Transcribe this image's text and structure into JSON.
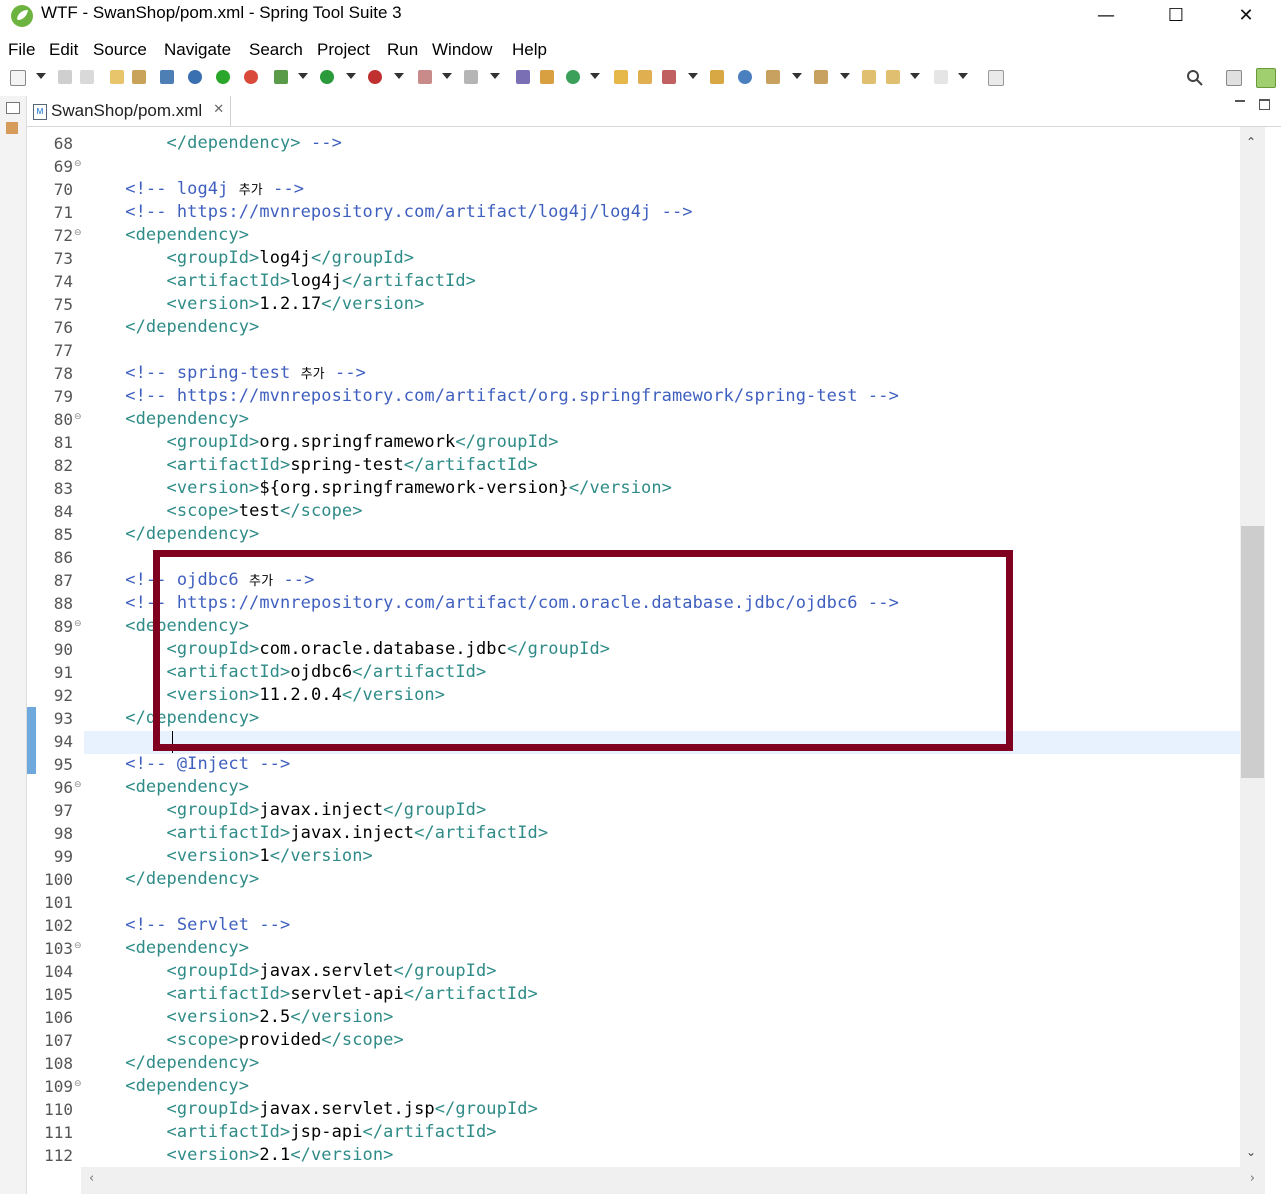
{
  "window": {
    "title": "WTF - SwanShop/pom.xml - Spring Tool Suite 3",
    "minimize": "—",
    "maximize": "☐",
    "close": "✕"
  },
  "menu": [
    "File",
    "Edit",
    "Source",
    "Navigate",
    "Search",
    "Project",
    "Run",
    "Window",
    "Help"
  ],
  "tab": {
    "label": "SwanShop/pom.xml",
    "close": "✕",
    "icon": "M"
  },
  "editor": {
    "lines": [
      {
        "n": "68",
        "fold": "",
        "parts": [
          [
            "i",
            "        "
          ],
          [
            "tag",
            "</dependency>"
          ],
          [
            "cmt",
            " -->"
          ]
        ]
      },
      {
        "n": "69",
        "fold": "⊖",
        "parts": []
      },
      {
        "n": "70",
        "fold": "",
        "parts": [
          [
            "i",
            "    "
          ],
          [
            "cmt",
            "<!-- log4j "
          ],
          [
            "ko",
            "추가"
          ],
          [
            "cmt",
            " -->"
          ]
        ]
      },
      {
        "n": "71",
        "fold": "",
        "parts": [
          [
            "i",
            "    "
          ],
          [
            "cmt",
            "<!-- https://mvnrepository.com/artifact/log4j/log4j -->"
          ]
        ]
      },
      {
        "n": "72",
        "fold": "⊖",
        "parts": [
          [
            "i",
            "    "
          ],
          [
            "tag",
            "<dependency>"
          ]
        ]
      },
      {
        "n": "73",
        "fold": "",
        "parts": [
          [
            "i",
            "        "
          ],
          [
            "tag",
            "<groupId>"
          ],
          [
            "txt",
            "log4j"
          ],
          [
            "tag",
            "</groupId>"
          ]
        ]
      },
      {
        "n": "74",
        "fold": "",
        "parts": [
          [
            "i",
            "        "
          ],
          [
            "tag",
            "<artifactId>"
          ],
          [
            "txt",
            "log4j"
          ],
          [
            "tag",
            "</artifactId>"
          ]
        ]
      },
      {
        "n": "75",
        "fold": "",
        "parts": [
          [
            "i",
            "        "
          ],
          [
            "tag",
            "<version>"
          ],
          [
            "txt",
            "1.2.17"
          ],
          [
            "tag",
            "</version>"
          ]
        ]
      },
      {
        "n": "76",
        "fold": "",
        "parts": [
          [
            "i",
            "    "
          ],
          [
            "tag",
            "</dependency>"
          ]
        ]
      },
      {
        "n": "77",
        "fold": "",
        "parts": []
      },
      {
        "n": "78",
        "fold": "",
        "parts": [
          [
            "i",
            "    "
          ],
          [
            "cmt",
            "<!-- spring-test "
          ],
          [
            "ko",
            "추가"
          ],
          [
            "cmt",
            " -->"
          ]
        ]
      },
      {
        "n": "79",
        "fold": "",
        "parts": [
          [
            "i",
            "    "
          ],
          [
            "cmt",
            "<!-- https://mvnrepository.com/artifact/org.springframework/spring-test -->"
          ]
        ]
      },
      {
        "n": "80",
        "fold": "⊖",
        "parts": [
          [
            "i",
            "    "
          ],
          [
            "tag",
            "<dependency>"
          ]
        ]
      },
      {
        "n": "81",
        "fold": "",
        "parts": [
          [
            "i",
            "        "
          ],
          [
            "tag",
            "<groupId>"
          ],
          [
            "txt",
            "org.springframework"
          ],
          [
            "tag",
            "</groupId>"
          ]
        ]
      },
      {
        "n": "82",
        "fold": "",
        "parts": [
          [
            "i",
            "        "
          ],
          [
            "tag",
            "<artifactId>"
          ],
          [
            "txt",
            "spring-test"
          ],
          [
            "tag",
            "</artifactId>"
          ]
        ]
      },
      {
        "n": "83",
        "fold": "",
        "parts": [
          [
            "i",
            "        "
          ],
          [
            "tag",
            "<version>"
          ],
          [
            "txt",
            "${org.springframework-version}"
          ],
          [
            "tag",
            "</version>"
          ]
        ]
      },
      {
        "n": "84",
        "fold": "",
        "parts": [
          [
            "i",
            "        "
          ],
          [
            "tag",
            "<scope>"
          ],
          [
            "txt",
            "test"
          ],
          [
            "tag",
            "</scope>"
          ]
        ]
      },
      {
        "n": "85",
        "fold": "",
        "parts": [
          [
            "i",
            "    "
          ],
          [
            "tag",
            "</dependency>"
          ]
        ]
      },
      {
        "n": "86",
        "fold": "",
        "parts": []
      },
      {
        "n": "87",
        "fold": "",
        "parts": [
          [
            "i",
            "    "
          ],
          [
            "cmt",
            "<!-- ojdbc6 "
          ],
          [
            "ko",
            "추가"
          ],
          [
            "cmt",
            " -->"
          ]
        ]
      },
      {
        "n": "88",
        "fold": "",
        "parts": [
          [
            "i",
            "    "
          ],
          [
            "cmt",
            "<!-- https://mvnrepository.com/artifact/com.oracle.database.jdbc/ojdbc6 -->"
          ]
        ]
      },
      {
        "n": "89",
        "fold": "⊖",
        "parts": [
          [
            "i",
            "    "
          ],
          [
            "tag",
            "<dependency>"
          ]
        ]
      },
      {
        "n": "90",
        "fold": "",
        "parts": [
          [
            "i",
            "        "
          ],
          [
            "tag",
            "<groupId>"
          ],
          [
            "txt",
            "com.oracle.database.jdbc"
          ],
          [
            "tag",
            "</groupId>"
          ]
        ]
      },
      {
        "n": "91",
        "fold": "",
        "parts": [
          [
            "i",
            "        "
          ],
          [
            "tag",
            "<artifactId>"
          ],
          [
            "txt",
            "ojdbc6"
          ],
          [
            "tag",
            "</artifactId>"
          ]
        ]
      },
      {
        "n": "92",
        "fold": "",
        "parts": [
          [
            "i",
            "        "
          ],
          [
            "tag",
            "<version>"
          ],
          [
            "txt",
            "11.2.0.4"
          ],
          [
            "tag",
            "</version>"
          ]
        ]
      },
      {
        "n": "93",
        "fold": "",
        "parts": [
          [
            "i",
            "    "
          ],
          [
            "tag",
            "</dependency>"
          ]
        ]
      },
      {
        "n": "94",
        "fold": "",
        "parts": []
      },
      {
        "n": "95",
        "fold": "",
        "parts": [
          [
            "i",
            "    "
          ],
          [
            "cmt",
            "<!-- @Inject -->"
          ]
        ]
      },
      {
        "n": "96",
        "fold": "⊖",
        "parts": [
          [
            "i",
            "    "
          ],
          [
            "tag",
            "<dependency>"
          ]
        ]
      },
      {
        "n": "97",
        "fold": "",
        "parts": [
          [
            "i",
            "        "
          ],
          [
            "tag",
            "<groupId>"
          ],
          [
            "txt",
            "javax.inject"
          ],
          [
            "tag",
            "</groupId>"
          ]
        ]
      },
      {
        "n": "98",
        "fold": "",
        "parts": [
          [
            "i",
            "        "
          ],
          [
            "tag",
            "<artifactId>"
          ],
          [
            "txt",
            "javax.inject"
          ],
          [
            "tag",
            "</artifactId>"
          ]
        ]
      },
      {
        "n": "99",
        "fold": "",
        "parts": [
          [
            "i",
            "        "
          ],
          [
            "tag",
            "<version>"
          ],
          [
            "txt",
            "1"
          ],
          [
            "tag",
            "</version>"
          ]
        ]
      },
      {
        "n": "100",
        "fold": "",
        "parts": [
          [
            "i",
            "    "
          ],
          [
            "tag",
            "</dependency>"
          ]
        ]
      },
      {
        "n": "101",
        "fold": "",
        "parts": []
      },
      {
        "n": "102",
        "fold": "",
        "parts": [
          [
            "i",
            "    "
          ],
          [
            "cmt",
            "<!-- Servlet -->"
          ]
        ]
      },
      {
        "n": "103",
        "fold": "⊖",
        "parts": [
          [
            "i",
            "    "
          ],
          [
            "tag",
            "<dependency>"
          ]
        ]
      },
      {
        "n": "104",
        "fold": "",
        "parts": [
          [
            "i",
            "        "
          ],
          [
            "tag",
            "<groupId>"
          ],
          [
            "txt",
            "javax.servlet"
          ],
          [
            "tag",
            "</groupId>"
          ]
        ]
      },
      {
        "n": "105",
        "fold": "",
        "parts": [
          [
            "i",
            "        "
          ],
          [
            "tag",
            "<artifactId>"
          ],
          [
            "txt",
            "servlet-api"
          ],
          [
            "tag",
            "</artifactId>"
          ]
        ]
      },
      {
        "n": "106",
        "fold": "",
        "parts": [
          [
            "i",
            "        "
          ],
          [
            "tag",
            "<version>"
          ],
          [
            "txt",
            "2.5"
          ],
          [
            "tag",
            "</version>"
          ]
        ]
      },
      {
        "n": "107",
        "fold": "",
        "parts": [
          [
            "i",
            "        "
          ],
          [
            "tag",
            "<scope>"
          ],
          [
            "txt",
            "provided"
          ],
          [
            "tag",
            "</scope>"
          ]
        ]
      },
      {
        "n": "108",
        "fold": "",
        "parts": [
          [
            "i",
            "    "
          ],
          [
            "tag",
            "</dependency>"
          ]
        ]
      },
      {
        "n": "109",
        "fold": "⊖",
        "parts": [
          [
            "i",
            "    "
          ],
          [
            "tag",
            "<dependency>"
          ]
        ]
      },
      {
        "n": "110",
        "fold": "",
        "parts": [
          [
            "i",
            "        "
          ],
          [
            "tag",
            "<groupId>"
          ],
          [
            "txt",
            "javax.servlet.jsp"
          ],
          [
            "tag",
            "</groupId>"
          ]
        ]
      },
      {
        "n": "111",
        "fold": "",
        "parts": [
          [
            "i",
            "        "
          ],
          [
            "tag",
            "<artifactId>"
          ],
          [
            "txt",
            "jsp-api"
          ],
          [
            "tag",
            "</artifactId>"
          ]
        ]
      },
      {
        "n": "112",
        "fold": "",
        "parts": [
          [
            "i",
            "        "
          ],
          [
            "tag",
            "<version>"
          ],
          [
            "txt",
            "2.1"
          ],
          [
            "tag",
            "</version>"
          ]
        ]
      }
    ]
  },
  "colors": {
    "tag": "#2e8b87",
    "comment": "#3f5fbf",
    "highlight_box": "#800020",
    "current_line": "#e8f2fe"
  },
  "icons": {
    "app": "spring-leaf-icon",
    "search": "search-icon",
    "perspective": "open-perspective-icon"
  }
}
